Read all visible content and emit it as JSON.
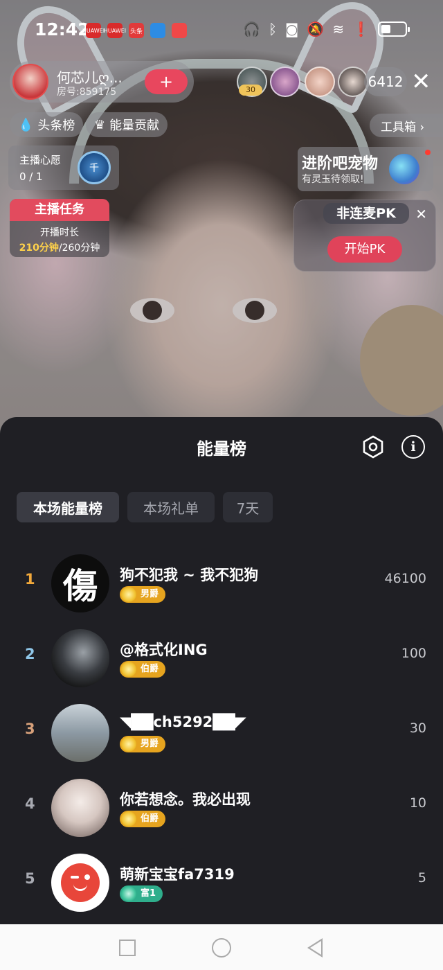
{
  "status_bar": {
    "time": "12:42",
    "apps": [
      "HUAWEI",
      "HUAWEI",
      "头条",
      "",
      ""
    ],
    "icons": [
      "headphones-icon",
      "bluetooth-icon",
      "camera-icon",
      "mute-icon",
      "wifi-icon",
      "alert-icon",
      "battery-icon"
    ]
  },
  "live": {
    "host_name": "何芯儿ღ...",
    "room_id": "房号:859175",
    "follow_label": "+",
    "viewer_badge": "30",
    "viewer_count": "6412",
    "close_label": "✕",
    "chips": {
      "headline": "头条榜",
      "energy": "能量贡献",
      "toolbox": "工具箱 ›"
    },
    "wish": {
      "title": "主播心愿",
      "count": "0 / 1",
      "icon_text": "千"
    },
    "pet": {
      "title": "进阶吧宠物",
      "subtitle": "有灵玉待领取!"
    },
    "task": {
      "title": "主播任务",
      "line1": "开播时长",
      "done": "210分钟",
      "total": "/260分钟"
    },
    "pk": {
      "title": "非连麦PK",
      "close": "✕",
      "button": "开始PK"
    }
  },
  "sheet": {
    "title": "能量榜",
    "tabs": [
      {
        "label": "本场能量榜",
        "active": true
      },
      {
        "label": "本场礼单",
        "active": false
      },
      {
        "label": "7天",
        "active": false
      }
    ],
    "rows": [
      {
        "rank": "1",
        "rank_color": "#f2a93b",
        "name": "狗不犯我 ~ 我不犯狗",
        "badge": "男爵",
        "badge_type": "gold",
        "score": "46100"
      },
      {
        "rank": "2",
        "rank_color": "#8fc6e8",
        "name": "@格式化ING",
        "badge": "伯爵",
        "badge_type": "gold",
        "score": "100"
      },
      {
        "rank": "3",
        "rank_color": "#d7a07a",
        "name": "◥██ch5292██◤",
        "badge": "男爵",
        "badge_type": "gold",
        "score": "30"
      },
      {
        "rank": "4",
        "rank_color": "#a8aab2",
        "name": "你若想念。我必出现",
        "badge": "伯爵",
        "badge_type": "gold",
        "score": "10"
      },
      {
        "rank": "5",
        "rank_color": "#a8aab2",
        "name": "萌新宝宝fa7319",
        "badge": "富1",
        "badge_type": "green",
        "score": "5"
      }
    ]
  },
  "colors": {
    "badge_gold": "#e6a41f",
    "badge_green": "#2fae8c",
    "accent_red": "#e0435a"
  }
}
